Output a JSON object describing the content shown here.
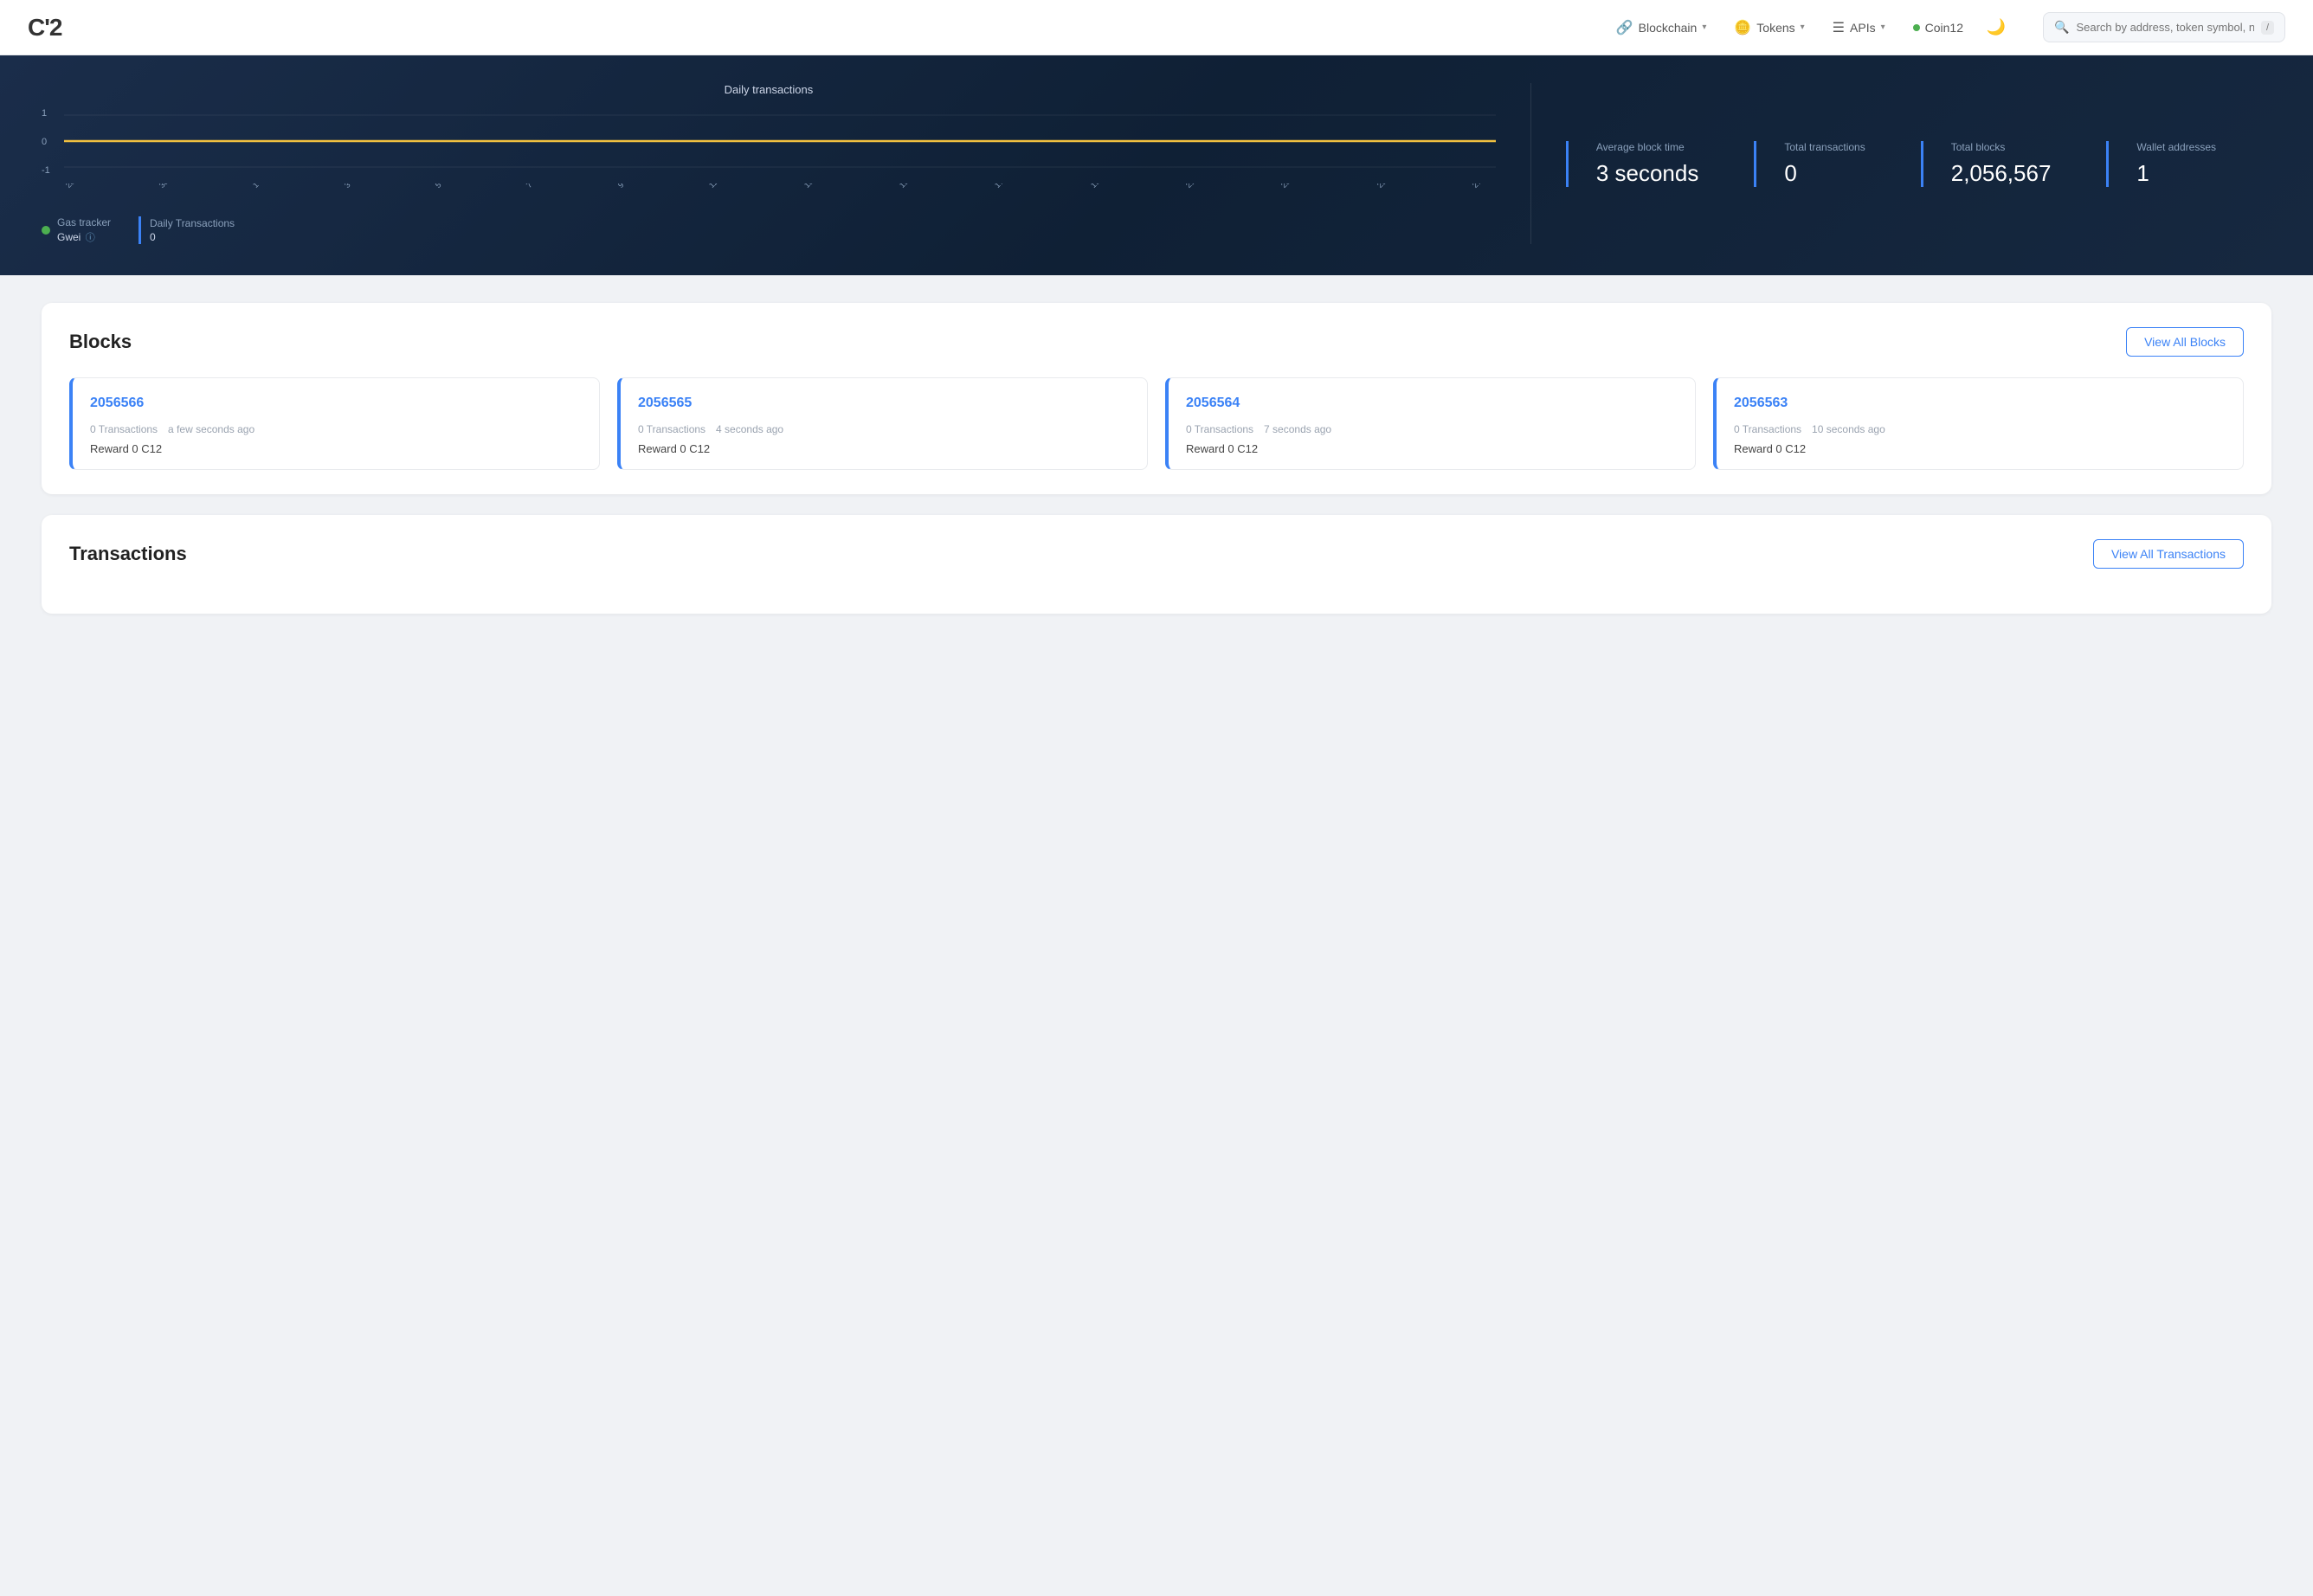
{
  "navbar": {
    "logo": "C'2",
    "nav_items": [
      {
        "label": "Blockchain",
        "icon": "🔗"
      },
      {
        "label": "Tokens",
        "icon": "🪙"
      },
      {
        "label": "APIs",
        "icon": "☰"
      }
    ],
    "coin": {
      "label": "Coin12",
      "dot_color": "#4caf50"
    },
    "search_placeholder": "Search by address, token symbol, n"
  },
  "hero": {
    "chart_title": "Daily transactions",
    "y_axis": [
      "1",
      "0",
      "-1"
    ],
    "x_axis_labels": [
      "28 Oct",
      "30 Oct",
      "1 Nov",
      "3 Nov",
      "5 Nov",
      "7 Nov",
      "9 Nov",
      "11 Nov",
      "13 Nov",
      "15 Nov",
      "17 Nov",
      "19 Nov",
      "21 Nov",
      "23 Nov",
      "25 Nov",
      "27 Nov"
    ],
    "legend": [
      {
        "type": "green",
        "label": "Gas tracker",
        "sublabel": "Gwei",
        "value": ""
      },
      {
        "type": "blue",
        "label": "Daily Transactions",
        "value": "0"
      }
    ]
  },
  "stats": [
    {
      "label": "Average block time",
      "value": "3 seconds"
    },
    {
      "label": "Total transactions",
      "value": "0"
    },
    {
      "label": "Total blocks",
      "value": "2,056,567"
    },
    {
      "label": "Wallet addresses",
      "value": "1"
    }
  ],
  "blocks_section": {
    "title": "Blocks",
    "view_all_label": "View All Blocks",
    "blocks": [
      {
        "number": "2056566",
        "transactions": "0 Transactions",
        "time": "a few seconds ago",
        "reward": "Reward 0 C12"
      },
      {
        "number": "2056565",
        "transactions": "0 Transactions",
        "time": "4 seconds ago",
        "reward": "Reward 0 C12"
      },
      {
        "number": "2056564",
        "transactions": "0 Transactions",
        "time": "7 seconds ago",
        "reward": "Reward 0 C12"
      },
      {
        "number": "2056563",
        "transactions": "0 Transactions",
        "time": "10 seconds ago",
        "reward": "Reward 0 C12"
      }
    ]
  },
  "transactions_section": {
    "title": "Transactions",
    "view_all_label": "View All Transactions"
  }
}
